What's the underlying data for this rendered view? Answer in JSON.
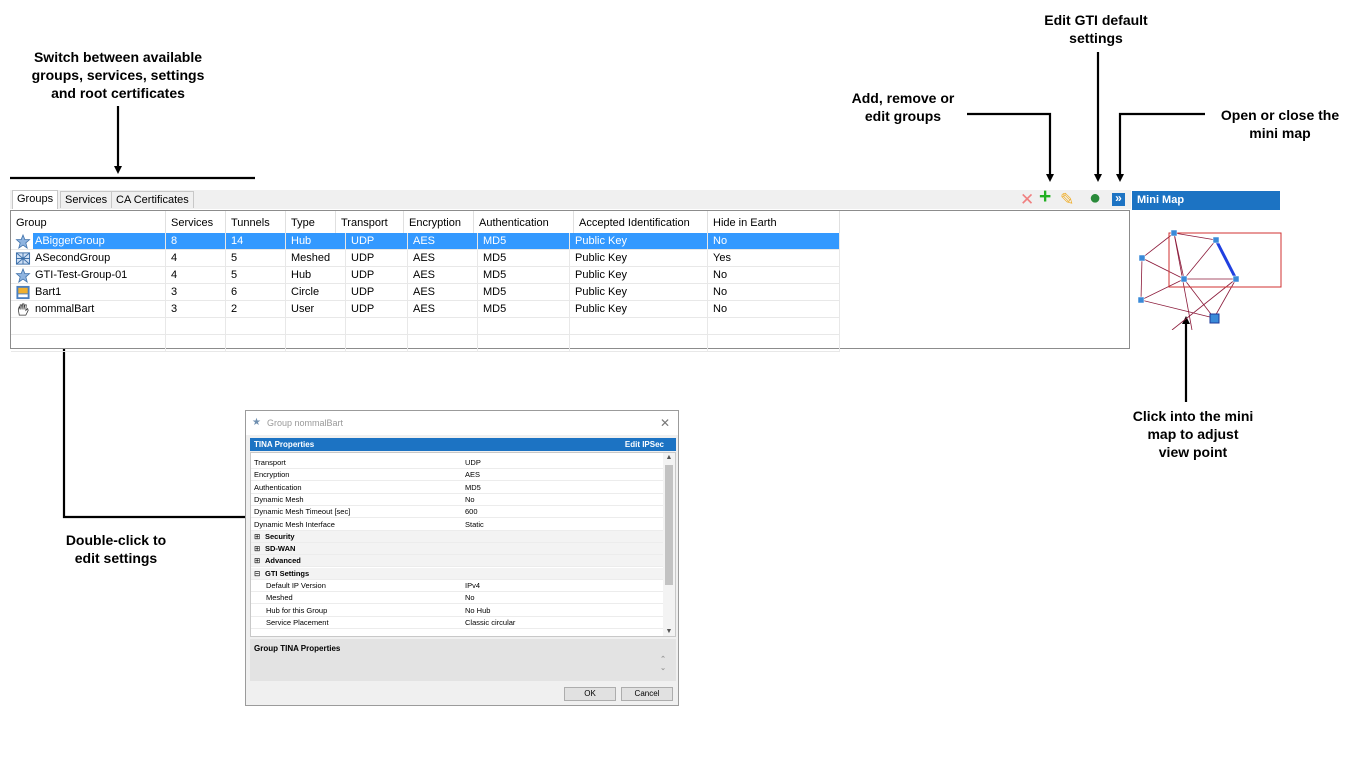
{
  "callouts": {
    "switch_tabs": "Switch between available\ngroups, services, settings\nand root certificates",
    "edit_default": "Edit GTI default\nsettings",
    "add_remove": "Add, remove or\nedit groups",
    "open_close_map": "Open or close the\nmini map",
    "double_click": "Double-click to\nedit settings",
    "click_minimap": "Click into the mini\nmap to adjust\nview point"
  },
  "tabs": [
    "Groups",
    "Services",
    "CA Certificates"
  ],
  "toolbar": {
    "remove_icon": "✕",
    "add_icon": "+",
    "edit_icon": "✎",
    "globe_icon": "●",
    "toggle_map_icon": "»"
  },
  "columns": [
    "Group",
    "Services",
    "Tunnels",
    "Type",
    "Transport",
    "Encryption",
    "Authentication",
    "Accepted Identification",
    "Hide in Earth"
  ],
  "rows": [
    {
      "icon": "star-icon",
      "cells": [
        "ABiggerGroup",
        "8",
        "14",
        "Hub",
        "UDP",
        "AES",
        "MD5",
        "Public Key",
        "No"
      ],
      "selected": true
    },
    {
      "icon": "mesh-icon",
      "cells": [
        "ASecondGroup",
        "4",
        "5",
        "Meshed",
        "UDP",
        "AES",
        "MD5",
        "Public Key",
        "Yes"
      ],
      "selected": false
    },
    {
      "icon": "star-icon",
      "cells": [
        "GTI-Test-Group-01",
        "4",
        "5",
        "Hub",
        "UDP",
        "AES",
        "MD5",
        "Public Key",
        "No"
      ],
      "selected": false
    },
    {
      "icon": "circle-icon",
      "cells": [
        "Bart1",
        "3",
        "6",
        "Circle",
        "UDP",
        "AES",
        "MD5",
        "Public Key",
        "No"
      ],
      "selected": false
    },
    {
      "icon": "hand-icon",
      "cells": [
        "nommalBart",
        "3",
        "2",
        "User",
        "UDP",
        "AES",
        "MD5",
        "Public Key",
        "No"
      ],
      "selected": false
    }
  ],
  "minimap": {
    "title": "Mini Map"
  },
  "dialog": {
    "title": "Group nommalBart",
    "header_left": "TINA Properties",
    "header_right": "Edit IPSec",
    "properties": [
      {
        "key": "Transport",
        "value": "UDP",
        "kind": "prop"
      },
      {
        "key": "Encryption",
        "value": "AES",
        "kind": "prop"
      },
      {
        "key": "Authentication",
        "value": "MD5",
        "kind": "prop"
      },
      {
        "key": "Dynamic Mesh",
        "value": "No",
        "kind": "prop"
      },
      {
        "key": "Dynamic Mesh Timeout [sec]",
        "value": "600",
        "kind": "prop"
      },
      {
        "key": "Dynamic Mesh Interface",
        "value": "Static",
        "kind": "prop"
      },
      {
        "key": "Security",
        "value": "",
        "kind": "cat",
        "pm": "⊞"
      },
      {
        "key": "SD-WAN",
        "value": "",
        "kind": "cat",
        "pm": "⊞"
      },
      {
        "key": "Advanced",
        "value": "",
        "kind": "cat",
        "pm": "⊞"
      },
      {
        "key": "GTI Settings",
        "value": "",
        "kind": "cat",
        "pm": "⊟"
      },
      {
        "key": "Default IP Version",
        "value": "IPv4",
        "kind": "sub"
      },
      {
        "key": "Meshed",
        "value": "No",
        "kind": "sub"
      },
      {
        "key": "Hub for this Group",
        "value": "No Hub",
        "kind": "sub"
      },
      {
        "key": "Service Placement",
        "value": "Classic circular",
        "kind": "sub"
      }
    ],
    "description": "Group TINA Properties",
    "ok_label": "OK",
    "cancel_label": "Cancel"
  }
}
